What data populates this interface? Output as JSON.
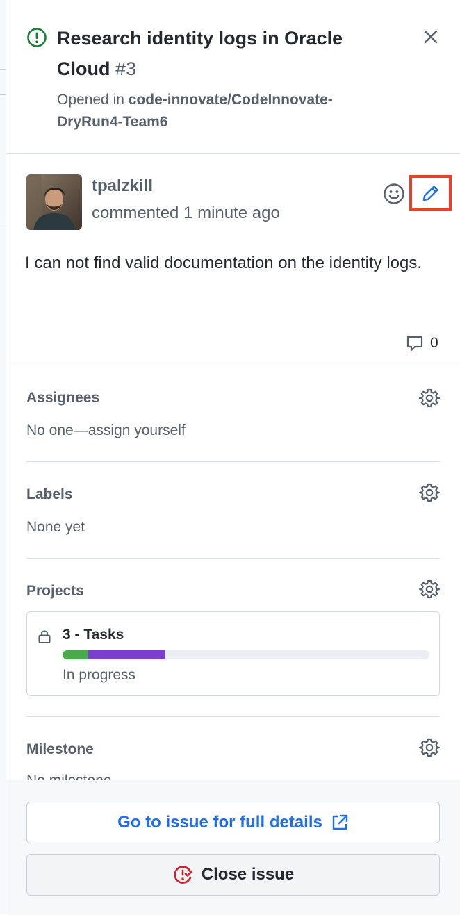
{
  "header": {
    "title": "Research identity logs in Oracle Cloud",
    "number": "#3",
    "opened_prefix": "Opened in",
    "repo": "code-innovate/CodeInnovate-DryRun4-Team6"
  },
  "comment": {
    "author": "tpalzkill",
    "time": "commented 1 minute ago",
    "body": "I can not find valid documentation on the identity logs.",
    "reply_count": "0"
  },
  "sidebar": {
    "assignees": {
      "title": "Assignees",
      "value": "No one—assign yourself"
    },
    "labels": {
      "title": "Labels",
      "value": "None yet"
    },
    "projects": {
      "title": "Projects",
      "name": "3 - Tasks",
      "status": "In progress",
      "progress": {
        "done_fraction": 0.07,
        "in_progress_fraction": 0.21
      }
    },
    "milestone": {
      "title": "Milestone",
      "value": "No milestone"
    }
  },
  "footer": {
    "goto_label": "Go to issue for full details",
    "close_label": "Close issue"
  },
  "colors": {
    "open_status": "#1a7f37",
    "link_blue": "#1f6feb",
    "highlight_red": "#e8402a",
    "close_red": "#cf222e",
    "progress_done": "#4aa94a",
    "progress_in_progress": "#7a3fce"
  },
  "icons": {
    "status": "issue-opened-icon",
    "close": "x-icon",
    "emoji": "smiley-icon",
    "edit": "pencil-icon",
    "comment": "comment-icon",
    "settings": "gear-icon",
    "lock": "lock-icon",
    "external": "link-external-icon",
    "close_issue": "issue-closed-icon"
  }
}
